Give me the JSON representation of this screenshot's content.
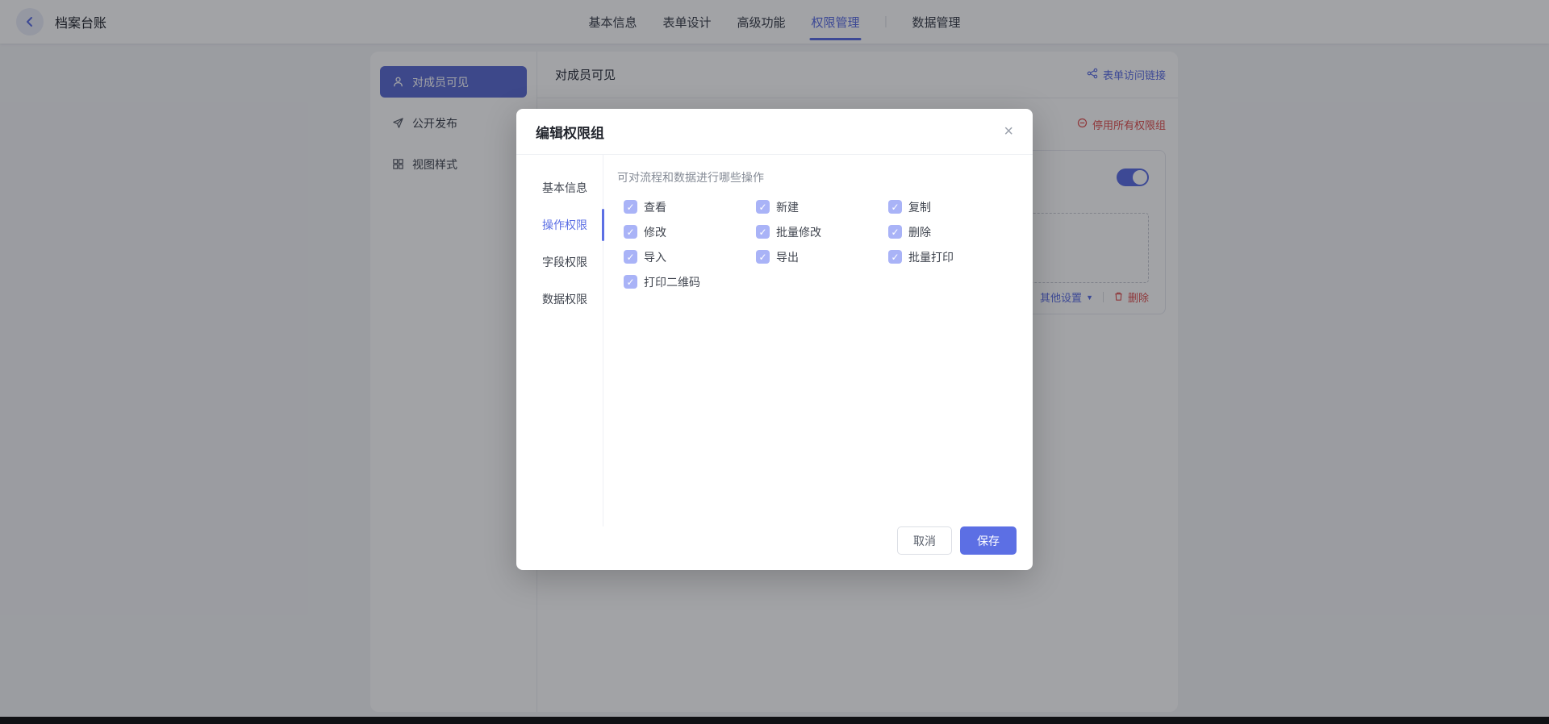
{
  "topbar": {
    "title": "档案台账",
    "tabs": [
      {
        "label": "基本信息",
        "active": false
      },
      {
        "label": "表单设计",
        "active": false
      },
      {
        "label": "高级功能",
        "active": false
      },
      {
        "label": "权限管理",
        "active": true
      },
      {
        "label": "数据管理",
        "active": false
      }
    ]
  },
  "sidebar": {
    "items": [
      {
        "label": "对成员可见",
        "icon": "user-icon",
        "selected": true
      },
      {
        "label": "公开发布",
        "icon": "send-icon",
        "selected": false
      },
      {
        "label": "视图样式",
        "icon": "grid-icon",
        "selected": false
      }
    ]
  },
  "panel": {
    "title": "对成员可见",
    "form_link_label": "表单访问链接",
    "disable_all_label": "停用所有权限组",
    "card": {
      "toggle_on": true,
      "other_settings_label": "其他设置",
      "delete_label": "删除"
    }
  },
  "modal": {
    "title": "编辑权限组",
    "close_glyph": "×",
    "tabs": [
      {
        "label": "基本信息",
        "active": false
      },
      {
        "label": "操作权限",
        "active": true
      },
      {
        "label": "字段权限",
        "active": false
      },
      {
        "label": "数据权限",
        "active": false
      }
    ],
    "section_label": "可对流程和数据进行哪些操作",
    "check_glyph": "✓",
    "permissions": [
      {
        "label": "查看",
        "checked": true
      },
      {
        "label": "新建",
        "checked": true
      },
      {
        "label": "复制",
        "checked": true
      },
      {
        "label": "修改",
        "checked": true
      },
      {
        "label": "批量修改",
        "checked": true
      },
      {
        "label": "删除",
        "checked": true
      },
      {
        "label": "导入",
        "checked": true
      },
      {
        "label": "导出",
        "checked": true
      },
      {
        "label": "批量打印",
        "checked": true
      },
      {
        "label": "打印二维码",
        "checked": true
      }
    ],
    "cancel_label": "取消",
    "save_label": "保存"
  },
  "colors": {
    "brand": "#5c6fe4",
    "selected": "#5d6cd2",
    "red": "#e05252",
    "cb": "#a9b3f7",
    "pagebg": "#f4f5f7"
  }
}
